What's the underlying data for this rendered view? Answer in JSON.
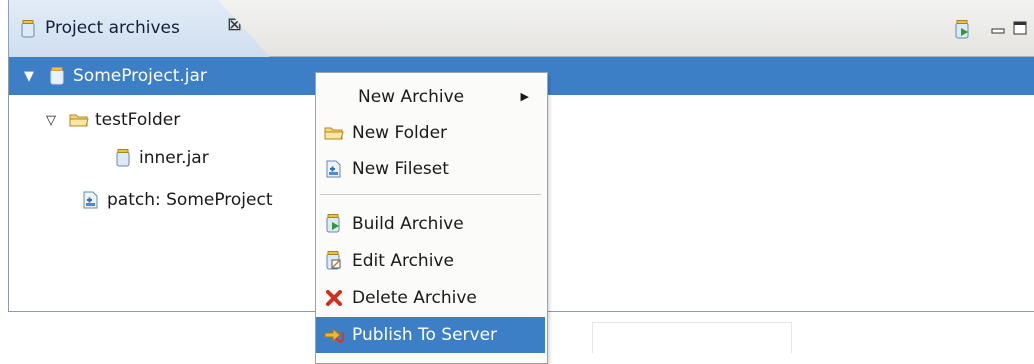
{
  "view": {
    "tab_title": "Project archives",
    "tab_close_glyph": "⊠",
    "toolbar_icons": [
      "build-archive-icon",
      "minimize-icon",
      "maximize-icon"
    ]
  },
  "tree": {
    "root": {
      "label": "SomeProject.jar",
      "icon": "jar-icon",
      "expanded": true
    },
    "folder": {
      "label": "testFolder",
      "icon": "folder-icon",
      "expanded": true
    },
    "inner": {
      "label": "inner.jar",
      "icon": "jar-icon"
    },
    "fileset": {
      "label": "patch: SomeProject",
      "icon": "fileset-icon"
    }
  },
  "context_menu": {
    "new_archive": "New Archive",
    "new_folder": "New Folder",
    "new_fileset": "New Fileset",
    "build_archive": "Build Archive",
    "edit_archive": "Edit Archive",
    "delete_archive": "Delete Archive",
    "publish_to_server": "Publish To Server",
    "highlighted": "Publish To Server"
  },
  "colors": {
    "selection": "#3d7fc6",
    "tab_bg": "#cfdeef"
  }
}
